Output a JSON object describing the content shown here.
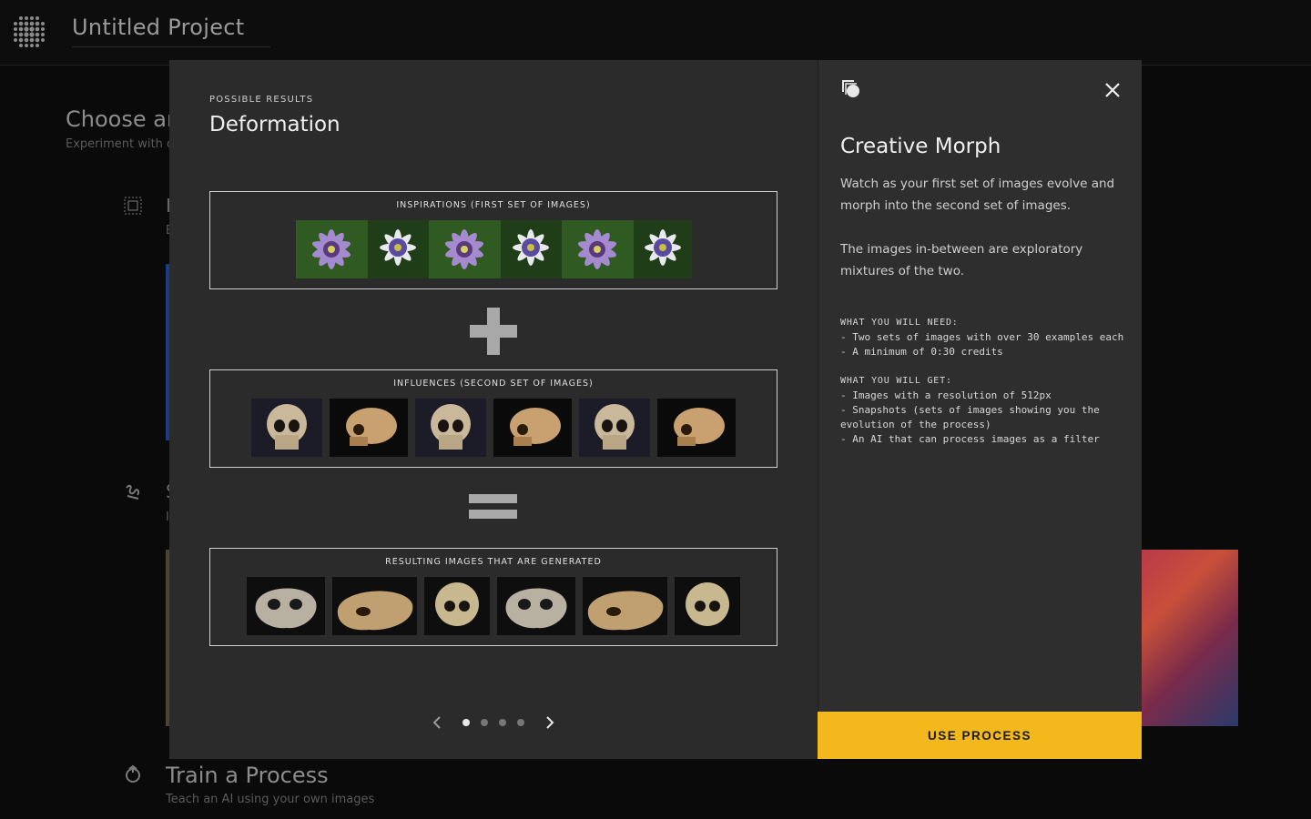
{
  "app": {
    "project_title": "Untitled Project"
  },
  "background": {
    "heading": "Choose ar",
    "subheading": "Experiment with c",
    "item1_letter": "I",
    "item1_sub": "E",
    "item2_letter": "S",
    "item2_sub": "I",
    "train_title": "Train a Process",
    "train_sub": "Teach an AI using your own images"
  },
  "modal": {
    "eyebrow": "POSSIBLE RESULTS",
    "heading": "Deformation",
    "inspirations_label": "INSPIRATIONS (FIRST SET OF IMAGES)",
    "plus_symbol": "+",
    "influences_label": "INFLUENCES (SECOND SET OF IMAGES)",
    "equals_symbol": "=",
    "results_label": "RESULTING IMAGES THAT ARE GENERATED",
    "carousel": {
      "count": 4,
      "active": 1
    }
  },
  "details": {
    "title": "Creative Morph",
    "para1": "Watch as your first set of images evolve and morph into the second set of images.",
    "para2": "The images in-between are exploratory mixtures of the two.",
    "need_heading": "WHAT YOU WILL NEED:",
    "need_items": [
      "- Two sets of images with over 30 examples each",
      "- A minimum of 0:30 credits"
    ],
    "get_heading": "WHAT YOU WILL GET:",
    "get_items": [
      "- Images with a resolution of 512px",
      "- Snapshots (sets of images showing you the evolution of the process)",
      "- An AI that can process images as a filter"
    ],
    "cta_label": "USE PROCESS"
  },
  "colors": {
    "accent": "#f3b91c",
    "modal_bg": "#2b2b2b",
    "panel_bg": "#2e2e2e"
  },
  "icons": {
    "app_logo": "dot-grid-icon",
    "close": "close-icon",
    "process": "morph-icon",
    "prev": "chevron-left-icon",
    "next": "chevron-right-icon"
  }
}
